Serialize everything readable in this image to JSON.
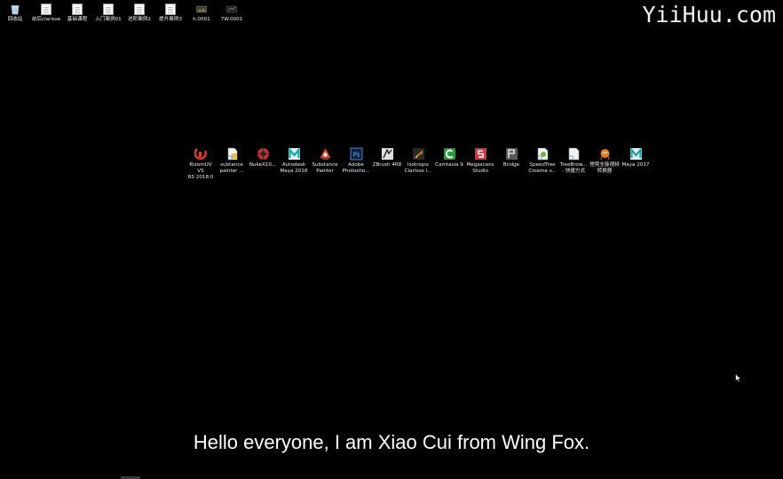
{
  "watermark": "YiiHuu.com",
  "subtitle": "Hello everyone, I am Xiao Cui from Wing Fox.",
  "top_icons": [
    {
      "label": "回收站",
      "icon": "recycle-bin-icon"
    },
    {
      "label": "前后clarisse",
      "icon": "document-icon"
    },
    {
      "label": "基础课程",
      "icon": "document-icon"
    },
    {
      "label": "入门案例01",
      "icon": "document-icon"
    },
    {
      "label": "进阶案例2",
      "icon": "document-icon"
    },
    {
      "label": "提升案例3",
      "icon": "document-icon"
    },
    {
      "label": "h.0001",
      "icon": "image-thumbnail-icon"
    },
    {
      "label": "7W.0001",
      "icon": "image-thumbnail-icon"
    }
  ],
  "app_icons": [
    {
      "label": "RizomUV VS\nRS 2018.0",
      "icon": "rizomuv-icon",
      "color": "#d8412f"
    },
    {
      "label": "subtance\npainter ...",
      "icon": "shortcut-file-icon",
      "color": "#e9e9e9"
    },
    {
      "label": "NukeX10...",
      "icon": "nuke-icon",
      "color": "#c63131"
    },
    {
      "label": "Autodesk\nMaya 2018",
      "icon": "maya-icon",
      "color": "#19a3a8"
    },
    {
      "label": "Substance\nPainter",
      "icon": "substance-painter-icon",
      "color": "#d8412f"
    },
    {
      "label": "Adobe\nPhotosho...",
      "icon": "photoshop-icon",
      "color": "#1b3c7a"
    },
    {
      "label": "ZBrush 4R8",
      "icon": "zbrush-icon",
      "color": "#d9d9d9"
    },
    {
      "label": "Isotropix\nClarisse i...",
      "icon": "clarisse-icon",
      "color": "#e06b2a"
    },
    {
      "label": "Camtasia 9",
      "icon": "camtasia-icon",
      "color": "#2f9a3c"
    },
    {
      "label": "Megascans\nStudio",
      "icon": "megascans-icon",
      "color": "#d8333f"
    },
    {
      "label": "Bridge",
      "icon": "bridge-icon",
      "color": "#8a8a8a"
    },
    {
      "label": "SpeedTree\nCinema v...",
      "icon": "speedtree-icon",
      "color": "#e9e9e9"
    },
    {
      "label": "TreeBrow...\n- 快捷方式",
      "icon": "shortcut-file-icon",
      "color": "#e9e9e9"
    },
    {
      "label": "狸窝全能视频\n转换器",
      "icon": "video-converter-icon",
      "color": "#e0801f"
    },
    {
      "label": "Maya 2017",
      "icon": "maya-icon",
      "color": "#19a3a8"
    }
  ]
}
